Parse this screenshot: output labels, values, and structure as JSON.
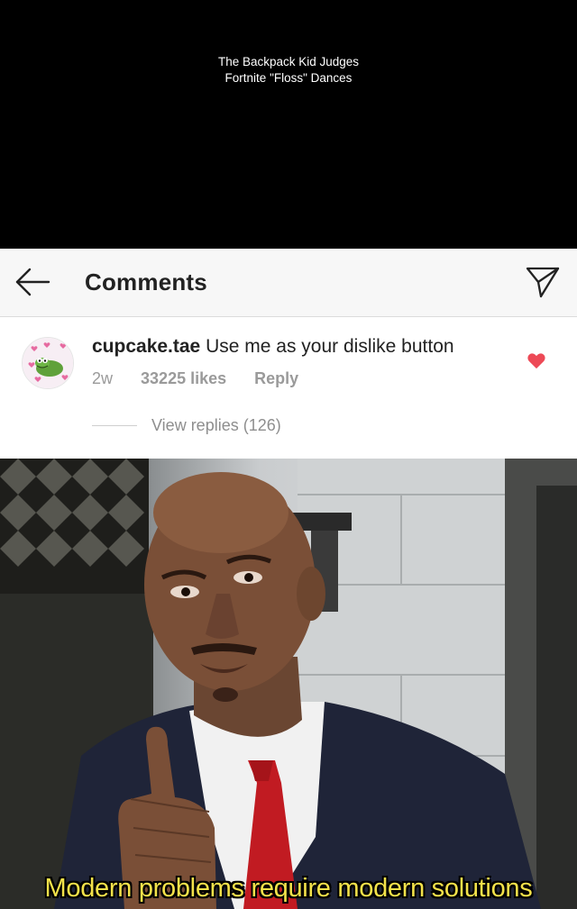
{
  "video": {
    "title_line1": "The Backpack Kid Judges",
    "title_line2": "Fortnite \"Floss\" Dances",
    "background": "#000000"
  },
  "header": {
    "title": "Comments",
    "back_icon": "arrow-left-icon",
    "send_icon": "paper-plane-icon"
  },
  "comment": {
    "username": "cupcake.tae",
    "text": "Use me as your dislike button",
    "time": "2w",
    "likes": "33225 likes",
    "reply_label": "Reply",
    "view_replies": "View replies (126)",
    "liked": true,
    "like_color": "#ed4956",
    "avatar_icon": "kermit-avatar"
  },
  "meme": {
    "caption": "Modern problems require modern solutions",
    "caption_color": "#f3e24a"
  }
}
